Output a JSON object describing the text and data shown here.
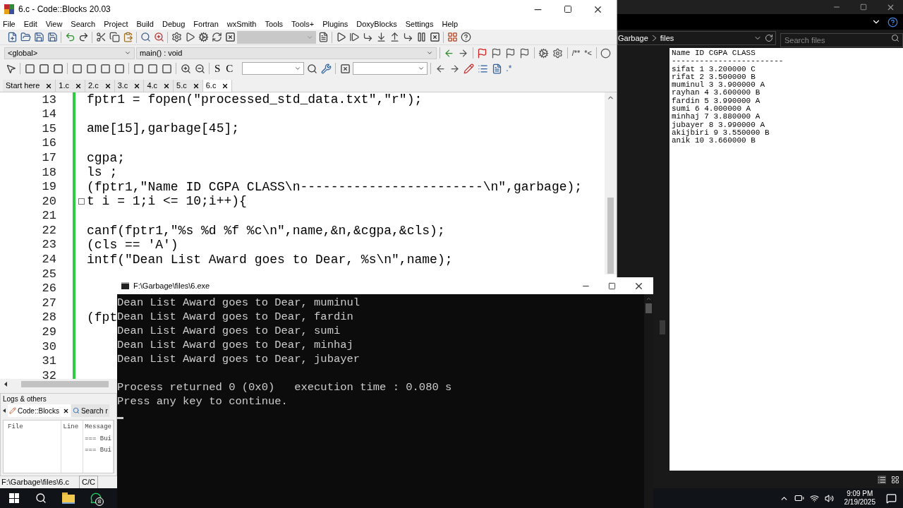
{
  "codeblocks": {
    "title": "6.c - Code::Blocks 20.03",
    "menu": [
      "File",
      "Edit",
      "View",
      "Search",
      "Project",
      "Build",
      "Debug",
      "Fortran",
      "wxSmith",
      "Tools",
      "Tools+",
      "Plugins",
      "DoxyBlocks",
      "Settings",
      "Help"
    ],
    "scope": "<global>",
    "function": "main() : void",
    "doc_buttons": [
      "/**",
      "*<"
    ],
    "style_buttons": [
      "S",
      "C"
    ],
    "regex_button": ".*",
    "tabs": [
      {
        "label": "Start here",
        "selected": false
      },
      {
        "label": "1.c",
        "selected": false
      },
      {
        "label": "2.c",
        "selected": false
      },
      {
        "label": "3.c",
        "selected": false
      },
      {
        "label": "4.c",
        "selected": false
      },
      {
        "label": "5.c",
        "selected": false
      },
      {
        "label": "6.c",
        "selected": true
      }
    ],
    "lines": [
      {
        "number": "13",
        "text": "fptr1 = fopen(\"processed_std_data.txt\",\"r\");"
      },
      {
        "number": "14"
      },
      {
        "number": "15",
        "text": "ame[15],garbage[45];"
      },
      {
        "number": "16"
      },
      {
        "number": "17",
        "text": "cgpa;"
      },
      {
        "number": "18",
        "text": "ls ;"
      },
      {
        "number": "19",
        "text": "(fptr1,\"Name ID CGPA CLASS\\n------------------------\\n\",garbage);"
      },
      {
        "number": "20",
        "text": "t i = 1;i <= 10;i++){",
        "fold": true
      },
      {
        "number": "21"
      },
      {
        "number": "22",
        "text": "canf(fptr1,\"%s %d %f %c\\n\",name,&n,&cgpa,&cls);"
      },
      {
        "number": "23",
        "text": "(cls == 'A')"
      },
      {
        "number": "24",
        "text": "intf(\"Dean List Award goes to Dear, %s\\n\",name);"
      },
      {
        "number": "25"
      },
      {
        "number": "26"
      },
      {
        "number": "27"
      },
      {
        "number": "28",
        "text": "(fpt"
      },
      {
        "number": "29"
      },
      {
        "number": "30"
      },
      {
        "number": "31"
      },
      {
        "number": "32"
      }
    ],
    "logs": {
      "title": "Logs & others",
      "tabs": [
        {
          "label": "Code::Blocks",
          "selected": true
        },
        {
          "label": "Search r",
          "selected": false
        }
      ],
      "columns": [
        "File",
        "Line",
        "Message"
      ],
      "rows": [
        {
          "message": "=== Bui"
        },
        {
          "message": "=== Bui"
        }
      ]
    },
    "status_bar": {
      "path": "F:\\Garbage\\files\\6.c",
      "language": "C/C"
    }
  },
  "explorer": {
    "breadcrumb": [
      "Garbage",
      "files"
    ],
    "search": {
      "placeholder": "Search files"
    },
    "file_lines": [
      "Name ID CGPA CLASS",
      "------------------------",
      "sifat 1 3.200000 C",
      "rifat 2 3.500000 B",
      "muminul 3 3.900000 A",
      "rayhan 4 3.600000 B",
      "fardin 5 3.990000 A",
      "sumi 6 4.000000 A",
      "minhaj 7 3.880000 A",
      "jubayer 8 3.990000 A",
      "akijbiri 9 3.550000 B",
      "anik 10 3.660000 B"
    ]
  },
  "console": {
    "title": "F:\\Garbage\\files\\6.exe",
    "output": [
      "Dean List Award goes to Dear, muminul",
      "Dean List Award goes to Dear, fardin",
      "Dean List Award goes to Dear, sumi",
      "Dean List Award goes to Dear, minhaj",
      "Dean List Award goes to Dear, jubayer"
    ],
    "summary": [
      "Process returned 0 (0x0)   execution time : 0.080 s",
      "Press any key to continue."
    ]
  },
  "taskbar": {
    "whatsapp_badge": "8",
    "time": "9:09 PM",
    "date": "2/19/2025"
  }
}
